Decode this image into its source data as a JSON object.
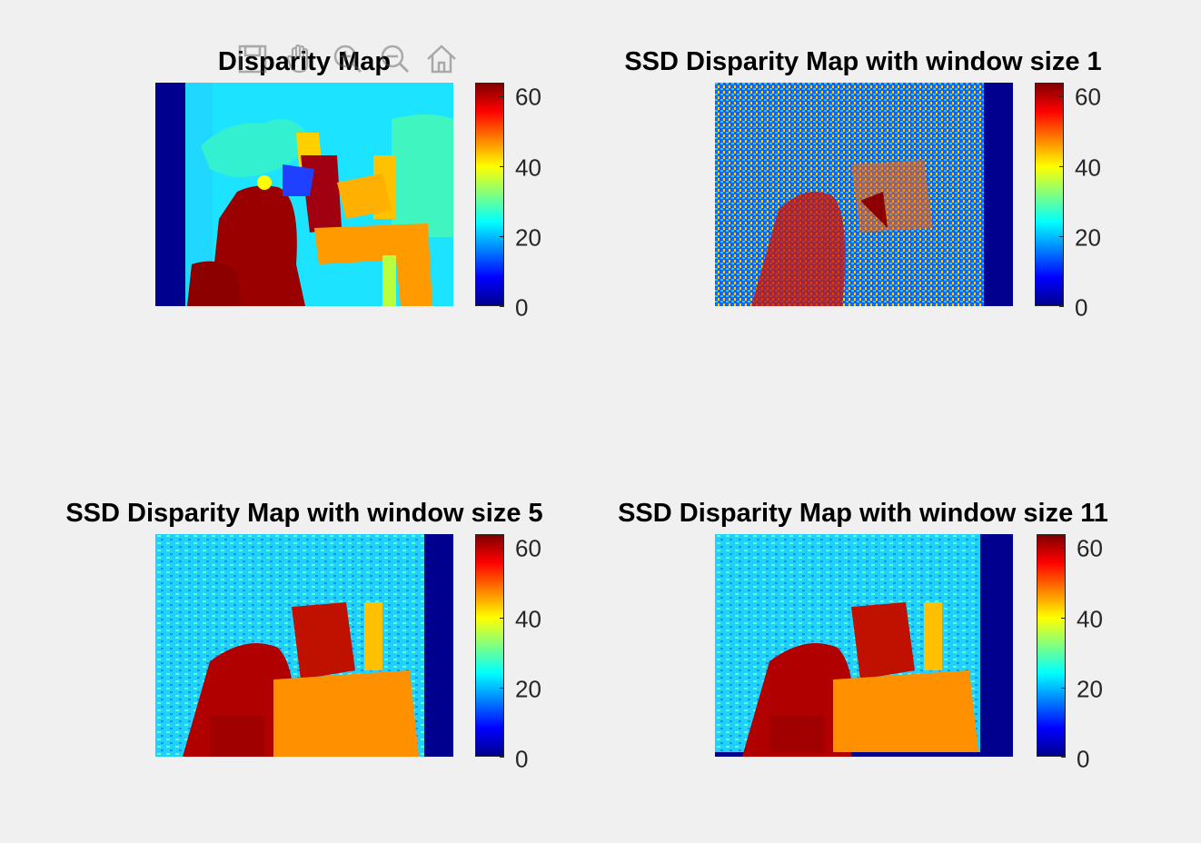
{
  "toolbar": {
    "items": [
      {
        "name": "save",
        "icon": "save-icon"
      },
      {
        "name": "pan",
        "icon": "hand-icon"
      },
      {
        "name": "zoom-in",
        "icon": "zoom-in-icon"
      },
      {
        "name": "zoom-out",
        "icon": "zoom-out-icon"
      },
      {
        "name": "home",
        "icon": "home-icon"
      }
    ]
  },
  "panels": [
    {
      "title": "Disparity Map",
      "colorbar_ticks": [
        "0",
        "20",
        "40",
        "60"
      ]
    },
    {
      "title": "SSD Disparity Map with window size 1",
      "colorbar_ticks": [
        "0",
        "20",
        "40",
        "60"
      ]
    },
    {
      "title": "SSD Disparity Map with window size 5",
      "colorbar_ticks": [
        "0",
        "20",
        "40",
        "60"
      ]
    },
    {
      "title": "SSD Disparity Map with window size 11",
      "colorbar_ticks": [
        "0",
        "20",
        "40",
        "60"
      ]
    }
  ],
  "colormap": "jet",
  "colors": {
    "background": "#f0f0f0",
    "jet_low": "#00008f",
    "jet_high": "#800000"
  }
}
